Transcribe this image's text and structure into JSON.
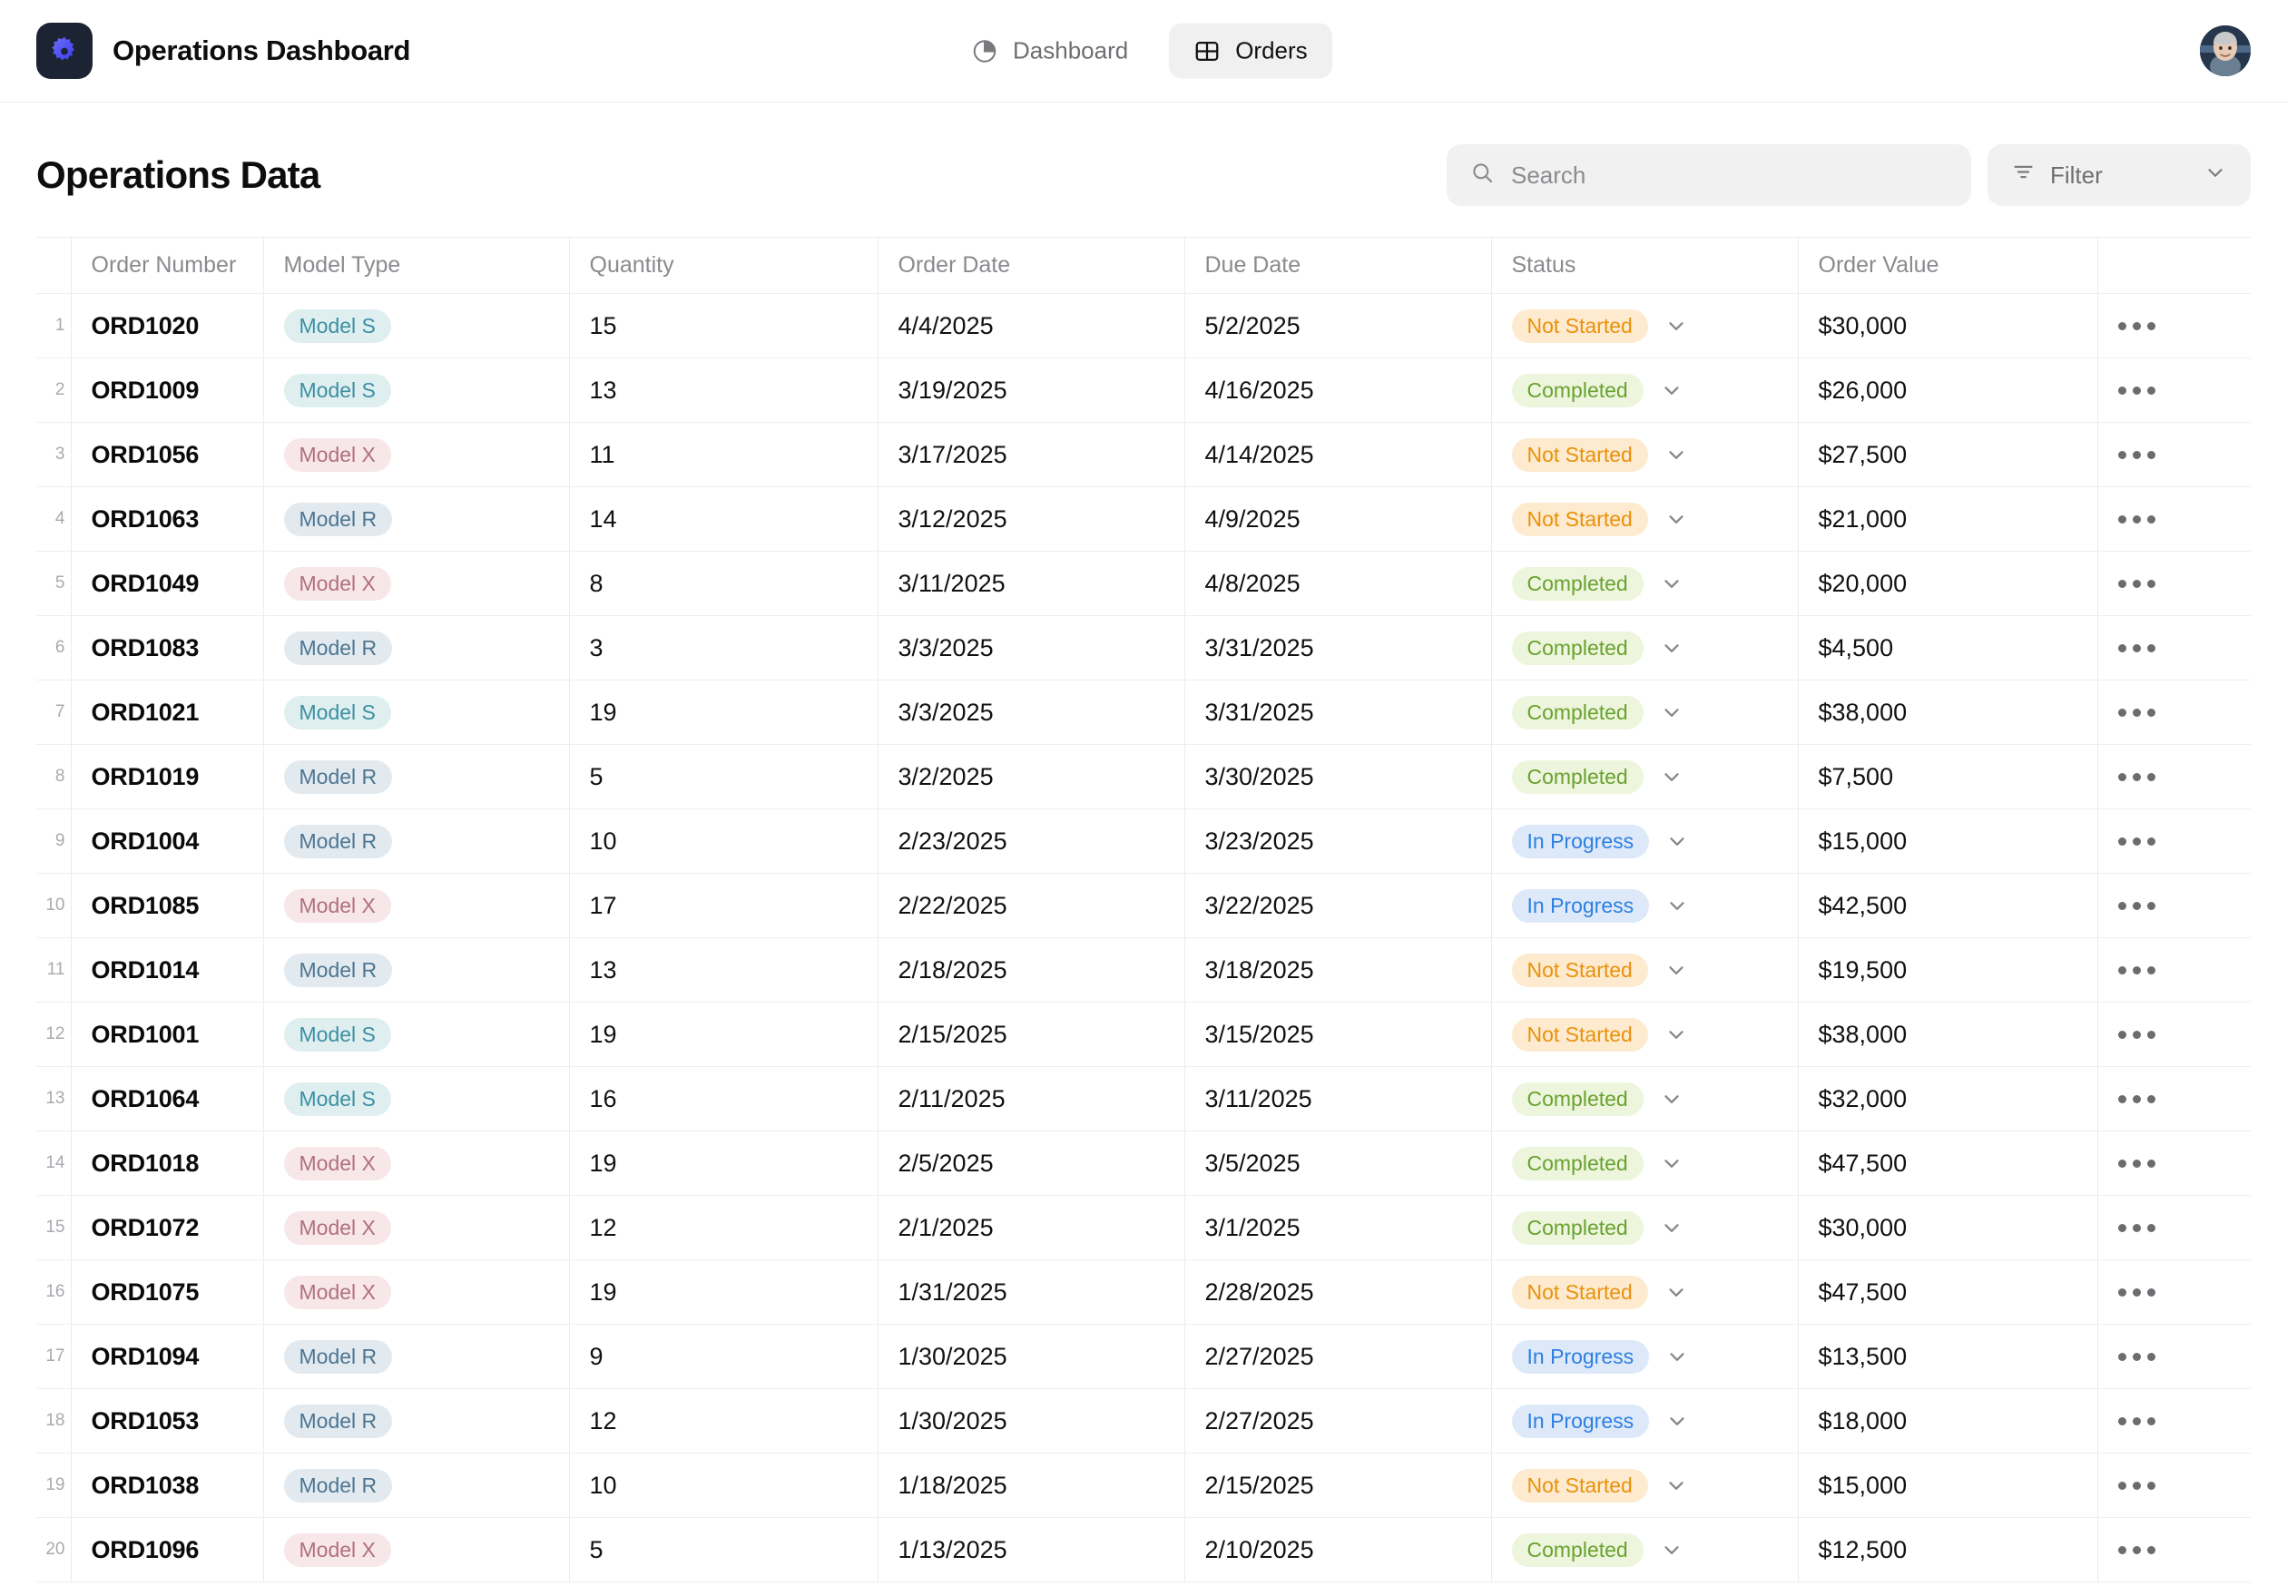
{
  "app": {
    "brand_title": "Operations Dashboard",
    "logo_icon": "gear-icon"
  },
  "nav": {
    "items": [
      {
        "label": "Dashboard",
        "icon": "pie-chart-icon",
        "active": false
      },
      {
        "label": "Orders",
        "icon": "table-grid-icon",
        "active": true
      }
    ]
  },
  "user": {
    "avatar_icon": "user-avatar-photo"
  },
  "page": {
    "title": "Operations Data"
  },
  "search": {
    "value": "",
    "placeholder": "Search",
    "icon": "search-icon"
  },
  "filter": {
    "label": "Filter",
    "icon": "filter-icon",
    "chevron": "chevron-down-icon"
  },
  "table": {
    "columns": [
      "Order Number",
      "Model Type",
      "Quantity",
      "Order Date",
      "Due Date",
      "Status",
      "Order Value"
    ],
    "colors": {
      "model_s": "#3c8fa3",
      "model_x": "#b2707a",
      "model_r": "#4d7591",
      "not_started": "#e8920d",
      "completed": "#69a22e",
      "in_progress": "#2e7fe1"
    },
    "rows": [
      {
        "index": "1",
        "order": "ORD1020",
        "model": "Model S",
        "model_key": "S",
        "qty": "15",
        "order_date": "4/4/2025",
        "due_date": "5/2/2025",
        "status": "Not Started",
        "status_key": "not",
        "value": "$30,000"
      },
      {
        "index": "2",
        "order": "ORD1009",
        "model": "Model S",
        "model_key": "S",
        "qty": "13",
        "order_date": "3/19/2025",
        "due_date": "4/16/2025",
        "status": "Completed",
        "status_key": "comp",
        "value": "$26,000"
      },
      {
        "index": "3",
        "order": "ORD1056",
        "model": "Model X",
        "model_key": "X",
        "qty": "11",
        "order_date": "3/17/2025",
        "due_date": "4/14/2025",
        "status": "Not Started",
        "status_key": "not",
        "value": "$27,500"
      },
      {
        "index": "4",
        "order": "ORD1063",
        "model": "Model R",
        "model_key": "R",
        "qty": "14",
        "order_date": "3/12/2025",
        "due_date": "4/9/2025",
        "status": "Not Started",
        "status_key": "not",
        "value": "$21,000"
      },
      {
        "index": "5",
        "order": "ORD1049",
        "model": "Model X",
        "model_key": "X",
        "qty": "8",
        "order_date": "3/11/2025",
        "due_date": "4/8/2025",
        "status": "Completed",
        "status_key": "comp",
        "value": "$20,000"
      },
      {
        "index": "6",
        "order": "ORD1083",
        "model": "Model R",
        "model_key": "R",
        "qty": "3",
        "order_date": "3/3/2025",
        "due_date": "3/31/2025",
        "status": "Completed",
        "status_key": "comp",
        "value": "$4,500"
      },
      {
        "index": "7",
        "order": "ORD1021",
        "model": "Model S",
        "model_key": "S",
        "qty": "19",
        "order_date": "3/3/2025",
        "due_date": "3/31/2025",
        "status": "Completed",
        "status_key": "comp",
        "value": "$38,000"
      },
      {
        "index": "8",
        "order": "ORD1019",
        "model": "Model R",
        "model_key": "R",
        "qty": "5",
        "order_date": "3/2/2025",
        "due_date": "3/30/2025",
        "status": "Completed",
        "status_key": "comp",
        "value": "$7,500"
      },
      {
        "index": "9",
        "order": "ORD1004",
        "model": "Model R",
        "model_key": "R",
        "qty": "10",
        "order_date": "2/23/2025",
        "due_date": "3/23/2025",
        "status": "In Progress",
        "status_key": "prog",
        "value": "$15,000"
      },
      {
        "index": "10",
        "order": "ORD1085",
        "model": "Model X",
        "model_key": "X",
        "qty": "17",
        "order_date": "2/22/2025",
        "due_date": "3/22/2025",
        "status": "In Progress",
        "status_key": "prog",
        "value": "$42,500"
      },
      {
        "index": "11",
        "order": "ORD1014",
        "model": "Model R",
        "model_key": "R",
        "qty": "13",
        "order_date": "2/18/2025",
        "due_date": "3/18/2025",
        "status": "Not Started",
        "status_key": "not",
        "value": "$19,500"
      },
      {
        "index": "12",
        "order": "ORD1001",
        "model": "Model S",
        "model_key": "S",
        "qty": "19",
        "order_date": "2/15/2025",
        "due_date": "3/15/2025",
        "status": "Not Started",
        "status_key": "not",
        "value": "$38,000"
      },
      {
        "index": "13",
        "order": "ORD1064",
        "model": "Model S",
        "model_key": "S",
        "qty": "16",
        "order_date": "2/11/2025",
        "due_date": "3/11/2025",
        "status": "Completed",
        "status_key": "comp",
        "value": "$32,000"
      },
      {
        "index": "14",
        "order": "ORD1018",
        "model": "Model X",
        "model_key": "X",
        "qty": "19",
        "order_date": "2/5/2025",
        "due_date": "3/5/2025",
        "status": "Completed",
        "status_key": "comp",
        "value": "$47,500"
      },
      {
        "index": "15",
        "order": "ORD1072",
        "model": "Model X",
        "model_key": "X",
        "qty": "12",
        "order_date": "2/1/2025",
        "due_date": "3/1/2025",
        "status": "Completed",
        "status_key": "comp",
        "value": "$30,000"
      },
      {
        "index": "16",
        "order": "ORD1075",
        "model": "Model X",
        "model_key": "X",
        "qty": "19",
        "order_date": "1/31/2025",
        "due_date": "2/28/2025",
        "status": "Not Started",
        "status_key": "not",
        "value": "$47,500"
      },
      {
        "index": "17",
        "order": "ORD1094",
        "model": "Model R",
        "model_key": "R",
        "qty": "9",
        "order_date": "1/30/2025",
        "due_date": "2/27/2025",
        "status": "In Progress",
        "status_key": "prog",
        "value": "$13,500"
      },
      {
        "index": "18",
        "order": "ORD1053",
        "model": "Model R",
        "model_key": "R",
        "qty": "12",
        "order_date": "1/30/2025",
        "due_date": "2/27/2025",
        "status": "In Progress",
        "status_key": "prog",
        "value": "$18,000"
      },
      {
        "index": "19",
        "order": "ORD1038",
        "model": "Model R",
        "model_key": "R",
        "qty": "10",
        "order_date": "1/18/2025",
        "due_date": "2/15/2025",
        "status": "Not Started",
        "status_key": "not",
        "value": "$15,000"
      },
      {
        "index": "20",
        "order": "ORD1096",
        "model": "Model X",
        "model_key": "X",
        "qty": "5",
        "order_date": "1/13/2025",
        "due_date": "2/10/2025",
        "status": "Completed",
        "status_key": "comp",
        "value": "$12,500"
      }
    ],
    "row_action_icon": "more-options-icon",
    "status_chevron_icon": "chevron-down-icon"
  }
}
